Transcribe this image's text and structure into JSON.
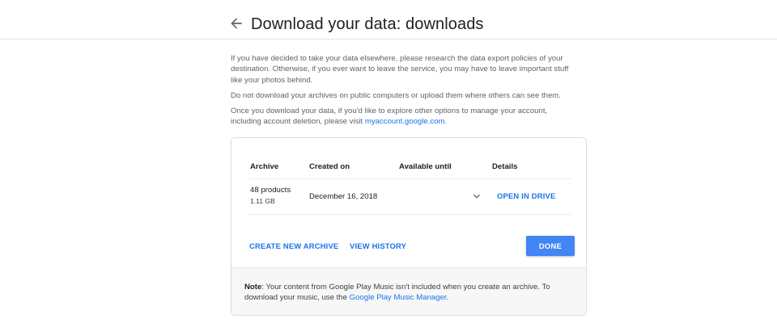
{
  "header": {
    "title": "Download your data: downloads",
    "back_icon": "arrow-back-icon"
  },
  "intro": {
    "p1": "If you have decided to take your data elsewhere, please research the data export policies of your destination. Otherwise, if you ever want to leave the service, you may have to leave important stuff like your photos behind.",
    "p2": "Do not download your archives on public computers or upload them where others can see them.",
    "p3_before": "Once you download your data, if you'd like to explore other options to manage your account, including account deletion, please visit ",
    "p3_link": "myaccount.google.com",
    "p3_after": "."
  },
  "table": {
    "headers": {
      "archive": "Archive",
      "created_on": "Created on",
      "available_until": "Available until",
      "details": "Details"
    },
    "rows": [
      {
        "products": "48 products",
        "size": "1.11 GB",
        "created_on": "December 16, 2018",
        "available_until": "",
        "details_action": "OPEN IN DRIVE",
        "expand_icon": "chevron-down-icon"
      }
    ]
  },
  "actions": {
    "create_new": "CREATE NEW ARCHIVE",
    "view_history": "VIEW HISTORY",
    "done": "DONE"
  },
  "note": {
    "label": "Note",
    "text_before": ": Your content from Google Play Music isn't included when you create an archive. To download your music, use the ",
    "link": "Google Play Music Manager",
    "text_after": "."
  },
  "colors": {
    "accent": "#1a73e8",
    "button": "#4285f4"
  }
}
